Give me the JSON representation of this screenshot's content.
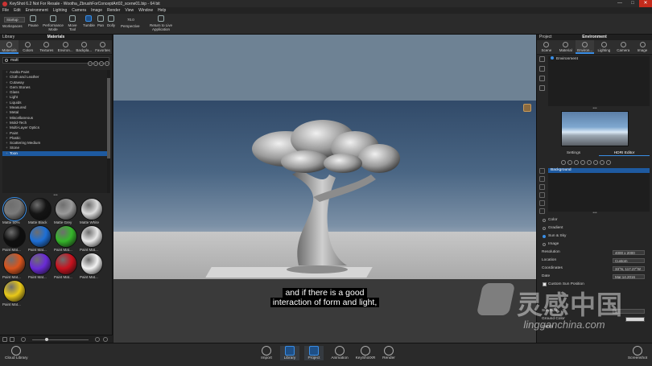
{
  "window": {
    "title": "KeyShot 6.2 Not For Resale - Wootha_ZbrushForConceptArt02_scene01.bip - 64 bit",
    "controls": [
      "—",
      "□",
      "✕"
    ]
  },
  "menu": [
    "File",
    "Edit",
    "Environment",
    "Lighting",
    "Camera",
    "Image",
    "Render",
    "View",
    "Window",
    "Help"
  ],
  "toolbar": {
    "startup": "Startup",
    "workspaces": "Workspaces",
    "pause": "Pause",
    "performance": "Performance Mode",
    "move_tool": "Move Tool",
    "tumble": "Tumble",
    "pan": "Pan",
    "dolly": "Dolly",
    "zoom": "70.0",
    "perspective": "Perspective",
    "return": "Return to Live Application"
  },
  "library": {
    "header": "Library",
    "header_center": "Materials",
    "tabs": [
      "Materials",
      "Colors",
      "Textures",
      "Environ...",
      "Backpla...",
      "Favorites"
    ],
    "search_value": "matt",
    "tree": [
      "Axalta Paint",
      "Cloth and Leather",
      "Cutaway",
      "Gem Stones",
      "Glass",
      "Light",
      "Liquids",
      "Measured",
      "Metal",
      "Miscellaneous",
      "Mold-Tech",
      "Multi-Layer Optics",
      "Paint",
      "Plastic",
      "Scattering Medium",
      "Stone",
      "Toon"
    ],
    "tree_selected": "Toon",
    "swatches": [
      {
        "label": "Matte 50%",
        "color": "#7a7a7a",
        "selected": true
      },
      {
        "label": "Matte Black",
        "color": "#141414"
      },
      {
        "label": "Matte Grey",
        "color": "#9a9a9a"
      },
      {
        "label": "Matte White",
        "color": "#dcdcdc"
      },
      {
        "label": "Paint Mat...",
        "color": "#0e0e0e"
      },
      {
        "label": "Paint Mat...",
        "color": "#1d6fd6"
      },
      {
        "label": "Paint Mat...",
        "color": "#35b52a"
      },
      {
        "label": "Paint Mat...",
        "color": "#e8e8e8"
      },
      {
        "label": "Paint Mat...",
        "color": "#d9541d"
      },
      {
        "label": "Paint Mat...",
        "color": "#6a2bd6"
      },
      {
        "label": "Paint Mat...",
        "color": "#c8121e"
      },
      {
        "label": "Paint Mat...",
        "color": "#f2f2f2"
      },
      {
        "label": "Paint Mat...",
        "color": "#e8c818"
      }
    ]
  },
  "viewport": {
    "subtitle_line1": "and if there is a good",
    "subtitle_line2": "interaction of form and light,"
  },
  "project": {
    "header": "Project",
    "header_center": "Environment",
    "tabs": [
      "Scene",
      "Material",
      "Environ...",
      "Lighting",
      "Camera",
      "Image"
    ],
    "env_item": "Environment",
    "hdri_tabs": [
      "Settings",
      "HDRI Editor"
    ],
    "layer": "Background",
    "radios": [
      {
        "label": "Color",
        "on": false
      },
      {
        "label": "Gradient",
        "on": false
      },
      {
        "label": "Sun & Sky",
        "on": true
      },
      {
        "label": "Image",
        "on": false
      }
    ],
    "props": [
      {
        "label": "Resolution",
        "value": "4000 x 2000"
      },
      {
        "label": "Location",
        "value": "Custom"
      },
      {
        "label": "Coordinates",
        "value": "33°N, 117.27°W"
      },
      {
        "label": "Date",
        "value": "Mar.14.2016"
      }
    ],
    "custom_sun": "Custom Sun Position",
    "sun_size_label": "Sun Size",
    "sun_size": "1",
    "ground_color": "Ground Color",
    "colors": "Colors"
  },
  "bottom": {
    "cloud_library": "Cloud Library",
    "buttons": [
      "Import",
      "Library",
      "Project",
      "Animation",
      "KeyShotXR",
      "Render"
    ],
    "screenshot": "Screenshot"
  },
  "watermark": {
    "cn": "灵感中国",
    "url": "lingganchina.com"
  }
}
